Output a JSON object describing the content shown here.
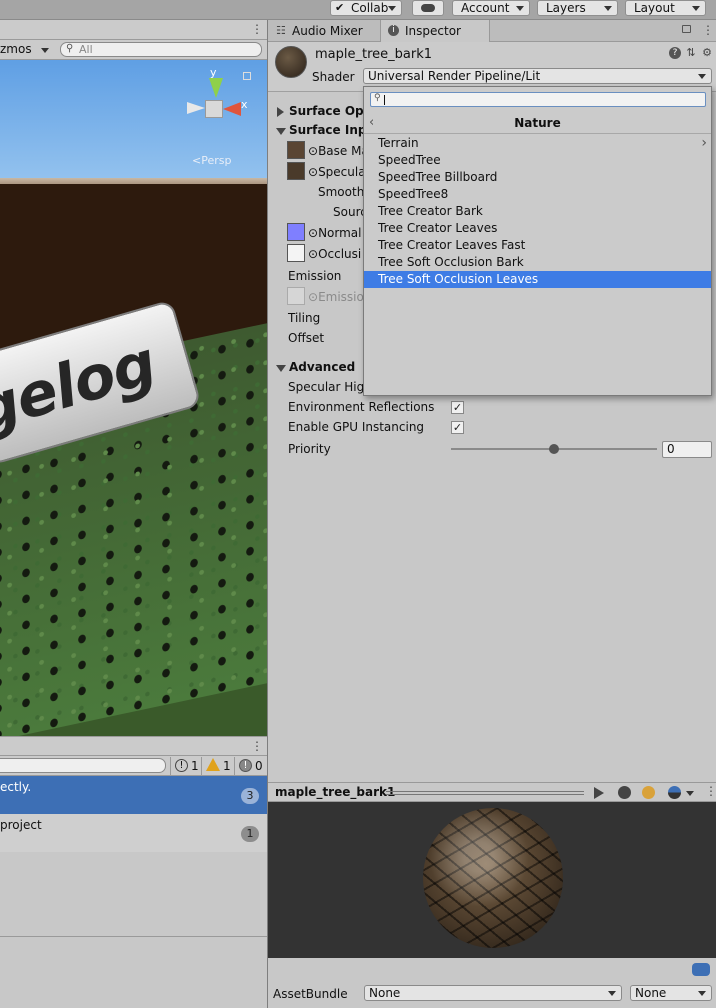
{
  "toolbar": {
    "collab": "Collab",
    "account": "Account",
    "layers": "Layers",
    "layout": "Layout"
  },
  "scene": {
    "gizmos_label": "zmos",
    "search_placeholder": "All",
    "axis_y": "y",
    "axis_x": "x",
    "persp_label": "<Persp",
    "logo_text": "gelog"
  },
  "console": {
    "counts": {
      "info": "1",
      "warning": "1",
      "error": "0"
    },
    "rows": [
      {
        "text": "ectly.",
        "count": "3",
        "selected": true
      },
      {
        "text": "project",
        "count": "1",
        "selected": false
      }
    ]
  },
  "inspector": {
    "tabs": [
      {
        "label": "Audio Mixer"
      },
      {
        "label": "Inspector"
      }
    ],
    "material_name": "maple_tree_bark1",
    "shader_label": "Shader",
    "shader_value": "Universal Render Pipeline/Lit",
    "sections": {
      "surface_options": "Surface Opti",
      "surface_inputs": "Surface Inpu",
      "base_map": "Base Ma",
      "specular": "Specula",
      "smoothness": "Smooth",
      "source": "Sourc",
      "normal": "Normal I",
      "occlusion": "Occlusi",
      "emission": "Emission",
      "emission_map": "Emission",
      "tiling": "Tiling",
      "offset": "Offset",
      "advanced": "Advanced",
      "specular_highlights": "Specular High",
      "env_reflections": "Environment Reflections",
      "gpu_instancing": "Enable GPU Instancing",
      "priority": "Priority",
      "priority_value": "0",
      "priority_fraction": 0.5
    }
  },
  "shader_popup": {
    "title": "Nature",
    "items": [
      {
        "label": "Terrain",
        "submenu": true,
        "selected": false
      },
      {
        "label": "SpeedTree",
        "submenu": false,
        "selected": false
      },
      {
        "label": "SpeedTree Billboard",
        "submenu": false,
        "selected": false
      },
      {
        "label": "SpeedTree8",
        "submenu": false,
        "selected": false
      },
      {
        "label": "Tree Creator Bark",
        "submenu": false,
        "selected": false
      },
      {
        "label": "Tree Creator Leaves",
        "submenu": false,
        "selected": false
      },
      {
        "label": "Tree Creator Leaves Fast",
        "submenu": false,
        "selected": false
      },
      {
        "label": "Tree Soft Occlusion Bark",
        "submenu": false,
        "selected": false
      },
      {
        "label": "Tree Soft Occlusion Leaves",
        "submenu": false,
        "selected": true
      }
    ]
  },
  "preview": {
    "title": "maple_tree_bark1"
  },
  "assetbundle": {
    "label": "AssetBundle",
    "name_value": "None",
    "variant_value": "None"
  },
  "colors": {
    "selection": "#3e7ce5",
    "normal_swatch": "#7f7fff",
    "console_selected": "#3d6fb5"
  }
}
